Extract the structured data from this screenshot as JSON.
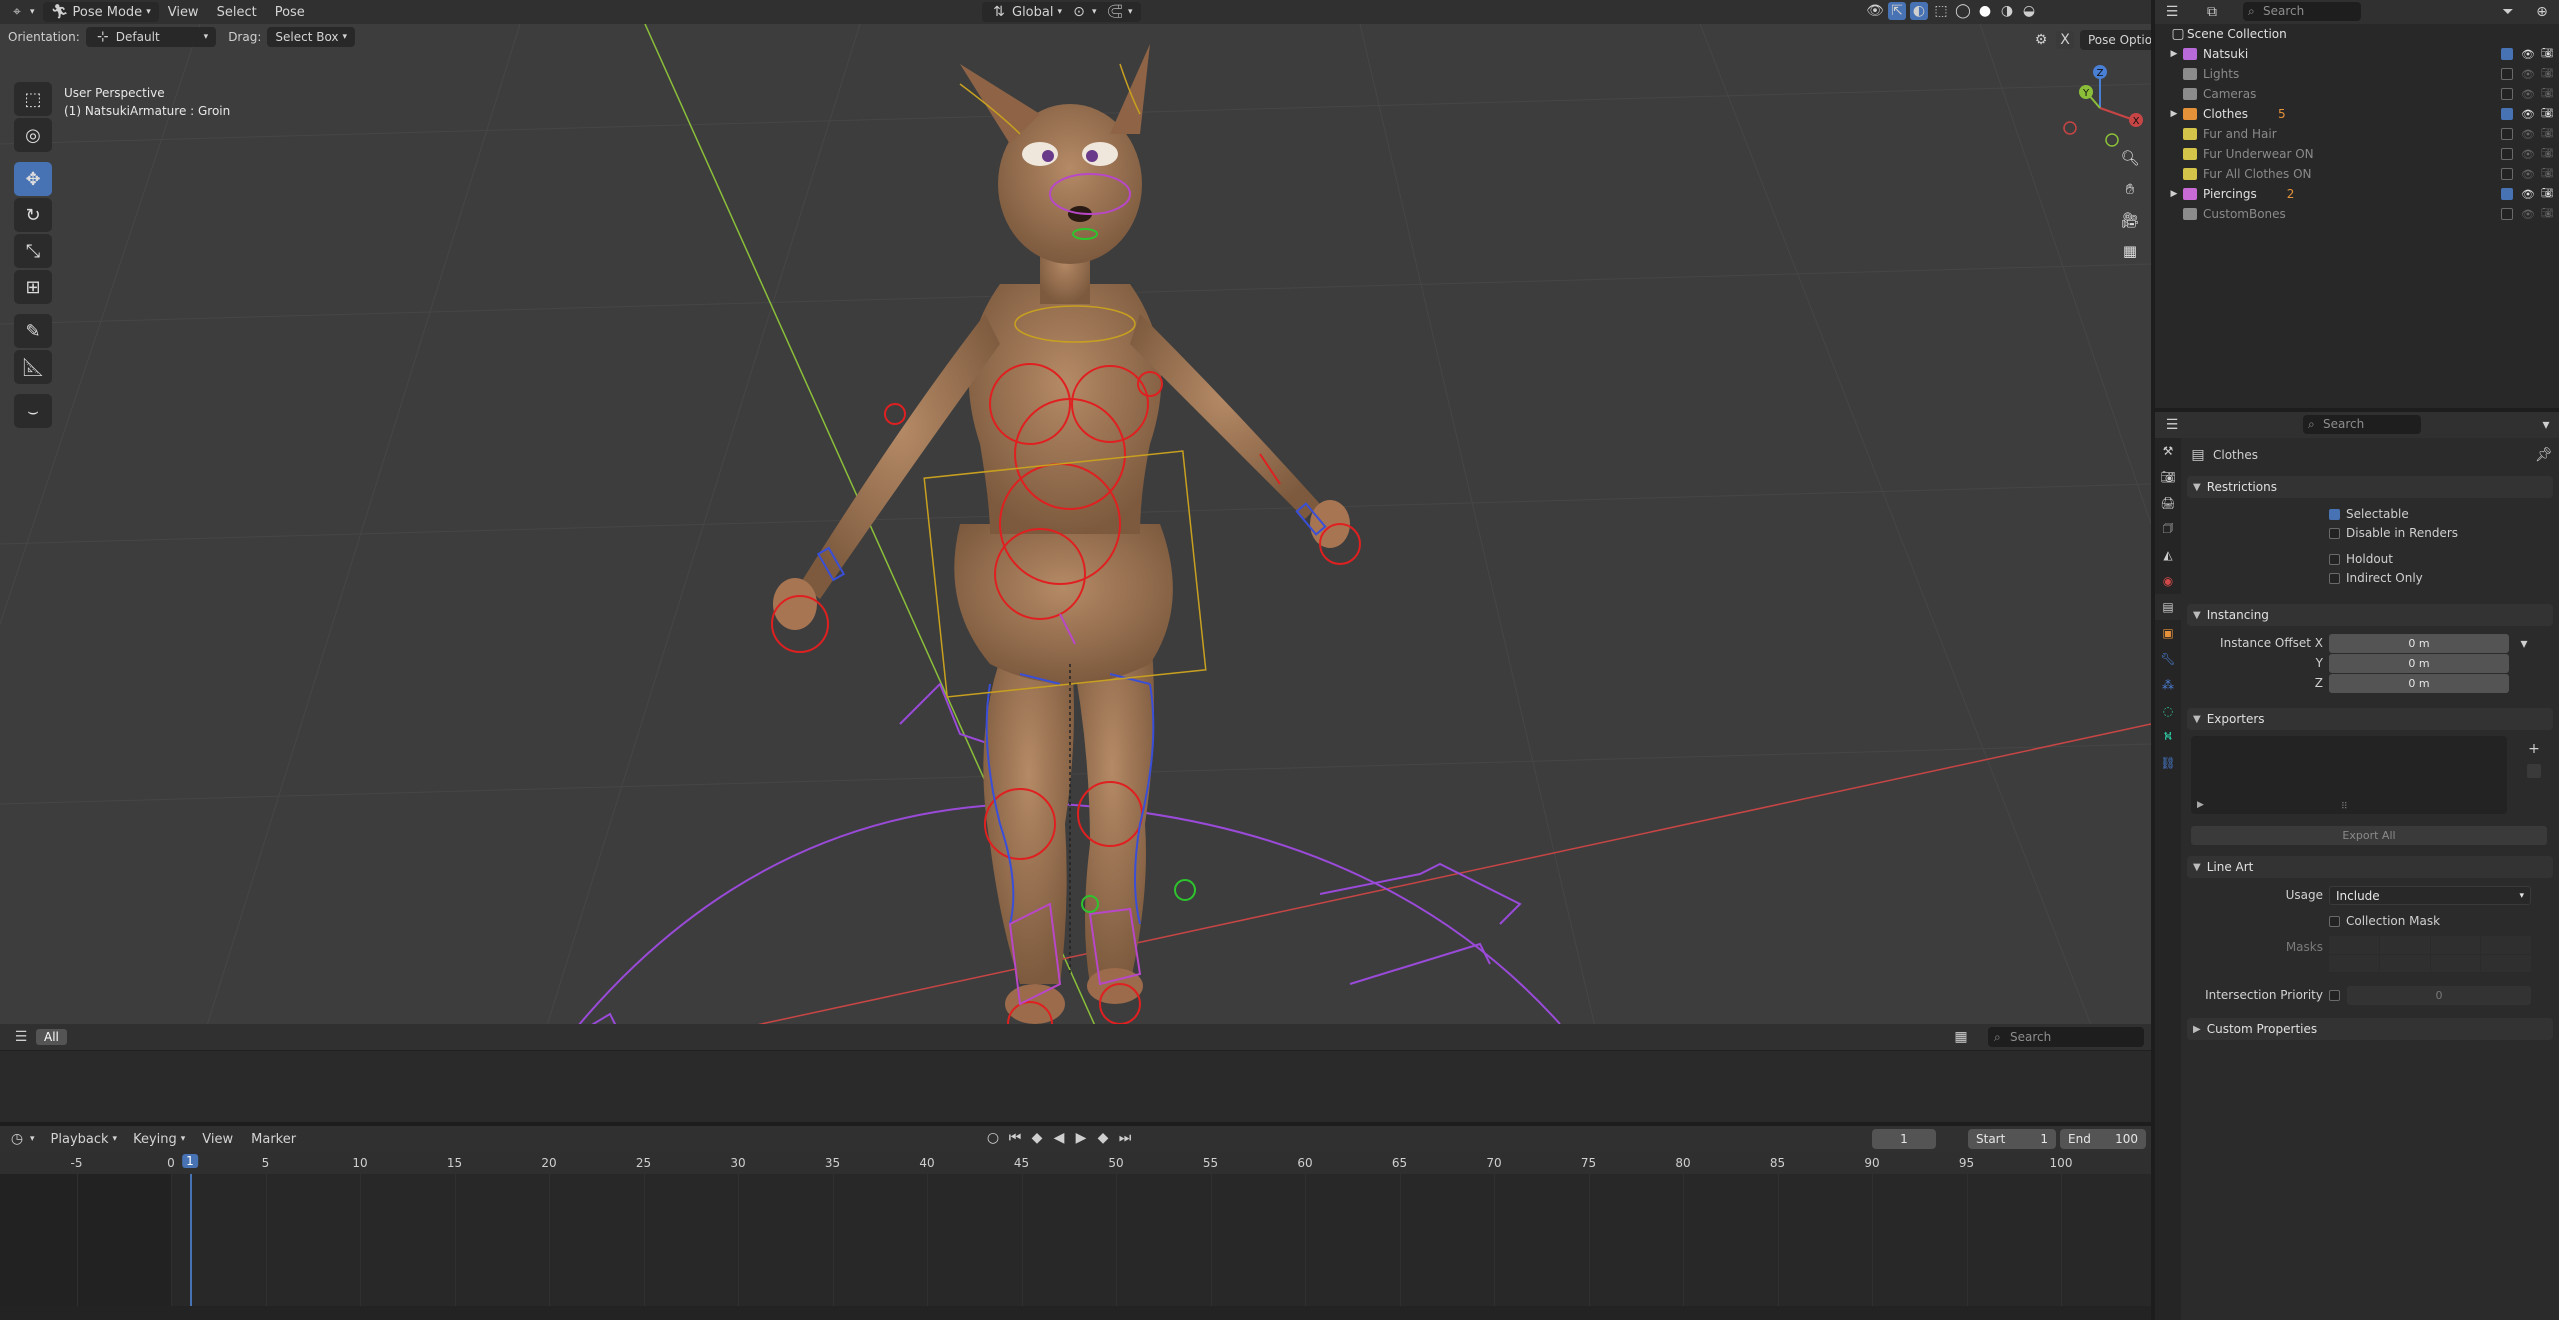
{
  "viewport_header": {
    "mode": "Pose Mode",
    "menus": [
      "View",
      "Select",
      "Pose"
    ],
    "transform_orientation": "Global",
    "pose_options": "Pose Options"
  },
  "viewport_header2": {
    "orientation_label": "Orientation:",
    "orientation_value": "Default",
    "drag_label": "Drag:",
    "drag_value": "Select Box"
  },
  "viewport_info": {
    "line1": "User Perspective",
    "line2": "(1) NatsukiArmature : Groin"
  },
  "gizmo": {
    "x": "X",
    "y": "Y",
    "z": "Z"
  },
  "asset_bar": {
    "all_label": "All",
    "search_placeholder": "Search"
  },
  "timeline": {
    "menus": [
      "Playback",
      "Keying",
      "View",
      "Marker"
    ],
    "current_frame": "1",
    "start_label": "Start",
    "start_value": "1",
    "end_label": "End",
    "end_value": "100",
    "ruler_ticks": [
      "-5",
      "0",
      "1",
      "5",
      "10",
      "15",
      "20",
      "25",
      "30",
      "35",
      "40",
      "45",
      "50",
      "55",
      "60",
      "65",
      "70",
      "75",
      "80",
      "85",
      "90",
      "95",
      "100"
    ]
  },
  "outliner": {
    "search_placeholder": "Search",
    "root": "Scene Collection",
    "items": [
      {
        "name": "Natsuki",
        "color": "#b86ad8",
        "dim": false,
        "expand": true,
        "checked": true,
        "badge": ""
      },
      {
        "name": "Lights",
        "color": "#8c8c8c",
        "dim": true,
        "expand": false,
        "checked": false,
        "badge": ""
      },
      {
        "name": "Cameras",
        "color": "#8c8c8c",
        "dim": true,
        "expand": false,
        "checked": false,
        "badge": ""
      },
      {
        "name": "Clothes",
        "color": "#e5913a",
        "dim": false,
        "expand": true,
        "checked": true,
        "badge": "5"
      },
      {
        "name": "Fur and Hair",
        "color": "#d4c54a",
        "dim": true,
        "expand": false,
        "checked": false,
        "badge": ""
      },
      {
        "name": "Fur Underwear ON",
        "color": "#d4c54a",
        "dim": true,
        "expand": false,
        "checked": false,
        "badge": ""
      },
      {
        "name": "Fur All Clothes ON",
        "color": "#d4c54a",
        "dim": true,
        "expand": false,
        "checked": false,
        "badge": ""
      },
      {
        "name": "Piercings",
        "color": "#c86bd6",
        "dim": false,
        "expand": true,
        "checked": true,
        "badge": "2"
      },
      {
        "name": "CustomBones",
        "color": "#8c8c8c",
        "dim": true,
        "expand": false,
        "checked": false,
        "badge": ""
      }
    ]
  },
  "properties": {
    "search_placeholder": "Search",
    "context_title": "Clothes",
    "restrictions": {
      "header": "Restrictions",
      "selectable": "Selectable",
      "disable_in_renders": "Disable in Renders",
      "holdout": "Holdout",
      "indirect_only": "Indirect Only"
    },
    "instancing": {
      "header": "Instancing",
      "offset_x_label": "Instance Offset X",
      "y_label": "Y",
      "z_label": "Z",
      "x_value": "0 m",
      "y_value": "0 m",
      "z_value": "0 m"
    },
    "exporters": {
      "header": "Exporters",
      "export_all": "Export All"
    },
    "line_art": {
      "header": "Line Art",
      "usage_label": "Usage",
      "usage_value": "Include",
      "collection_mask": "Collection Mask",
      "masks_label": "Masks",
      "intersection_priority_label": "Intersection Priority",
      "intersection_priority_value": "0"
    },
    "custom_properties": "Custom Properties"
  },
  "colors": {
    "accent": "#4772b3",
    "bone_red": "#e02020",
    "bone_blue": "#3a4fd8",
    "bone_purple": "#9a4ad8",
    "x_axis": "#c84545",
    "y_axis": "#8bbf3a"
  }
}
